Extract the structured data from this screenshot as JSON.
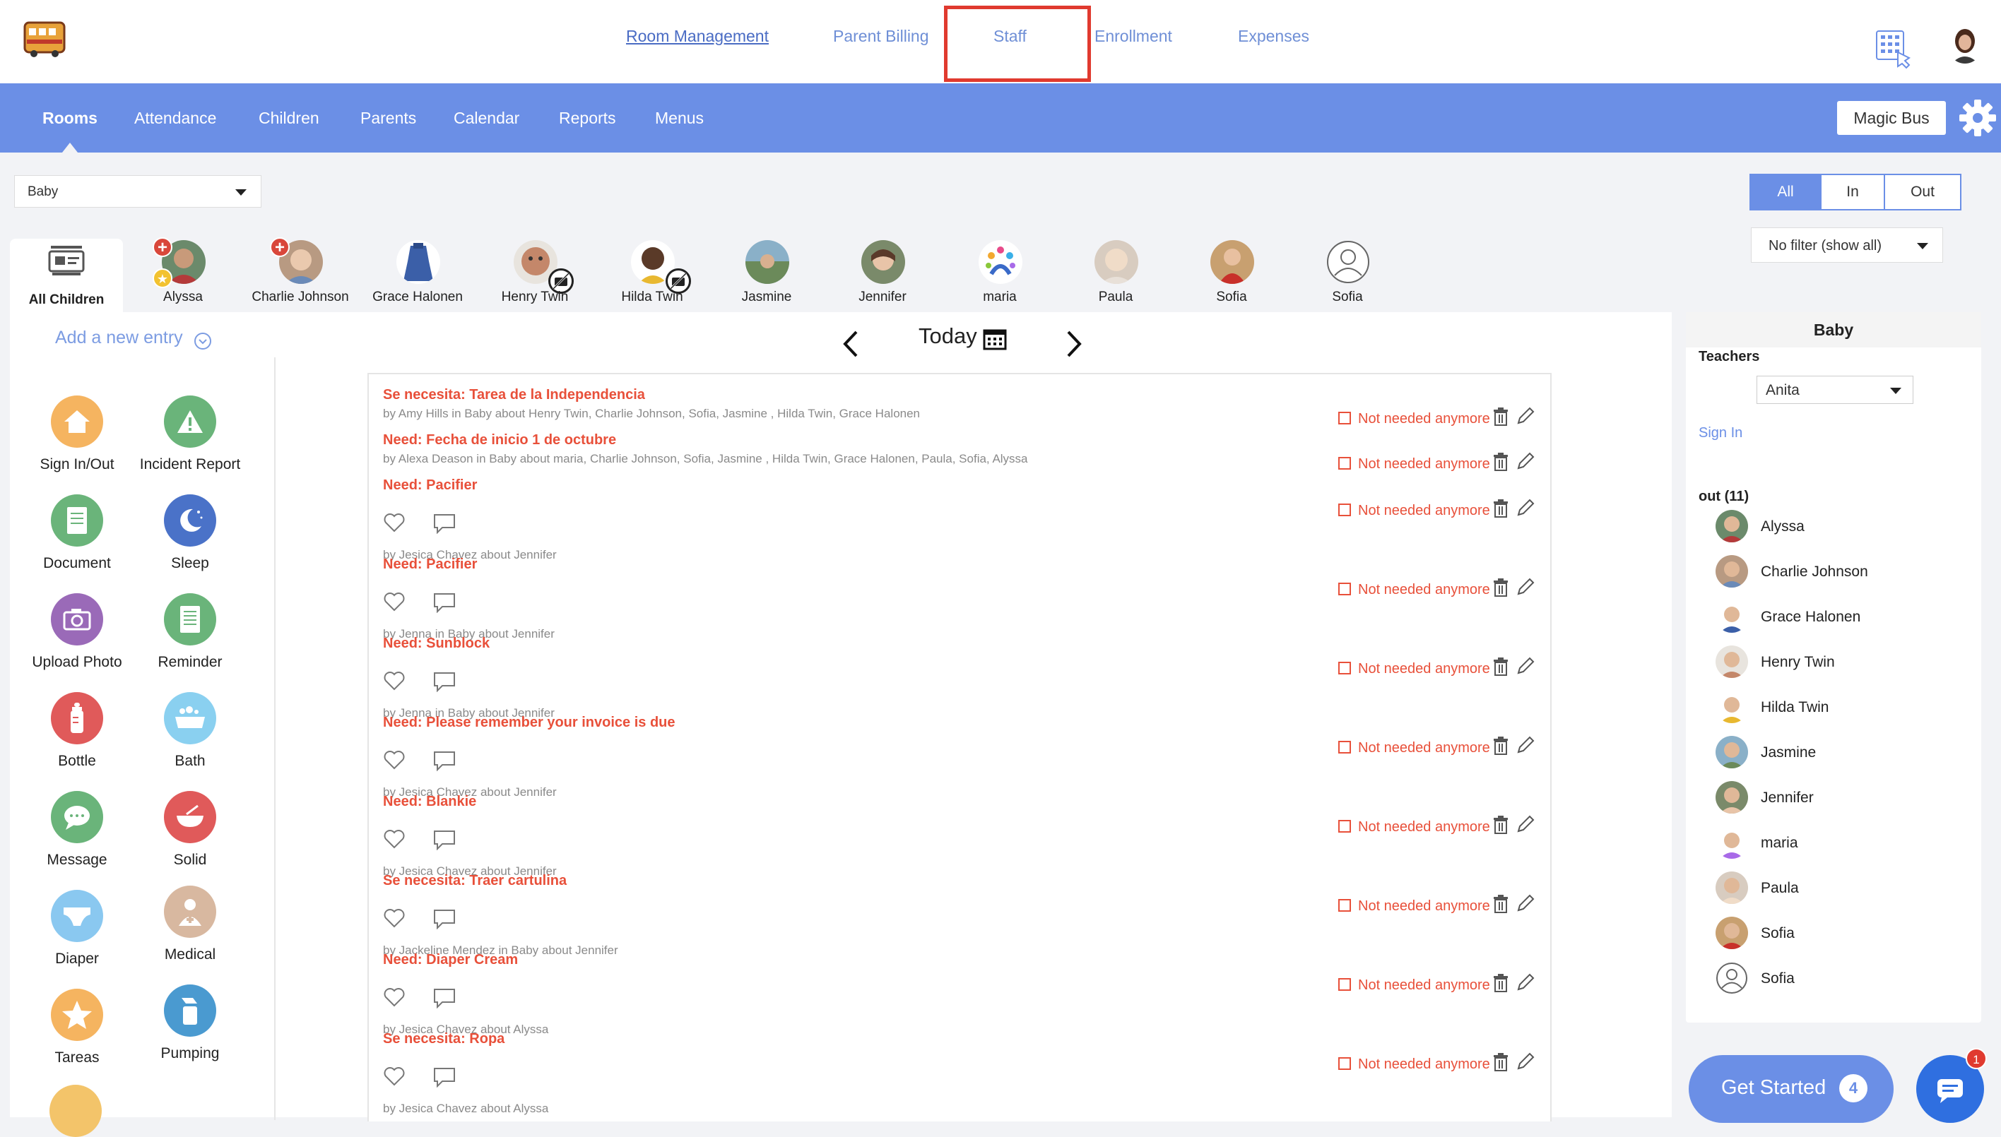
{
  "topnav": {
    "items": [
      {
        "label": "Room Management",
        "x": 0
      },
      {
        "label": "Parent Billing"
      },
      {
        "label": "Staff"
      },
      {
        "label": "Enrollment"
      },
      {
        "label": "Expenses"
      }
    ]
  },
  "bluenav": {
    "items": [
      "Rooms",
      "Attendance",
      "Children",
      "Parents",
      "Calendar",
      "Reports",
      "Menus"
    ],
    "school": "Magic Bus"
  },
  "room_select": {
    "value": "Baby"
  },
  "filters": {
    "all": "All",
    "in": "In",
    "out": "Out",
    "status": "No filter (show all)"
  },
  "children_bar": {
    "all_label": "All Children",
    "kids": [
      "Alyssa",
      "Charlie Johnson",
      "Grace Halonen",
      "Henry Twin",
      "Hilda Twin",
      "Jasmine",
      "Jennifer",
      "maria",
      "Paula",
      "Sofia",
      "Sofia"
    ]
  },
  "add_entry": "Add a new entry",
  "actions": [
    "Sign In/Out",
    "Incident Report",
    "Document",
    "Sleep",
    "Upload Photo",
    "Reminder",
    "Bottle",
    "Bath",
    "Message",
    "Solid",
    "Diaper",
    "Medical",
    "Tareas",
    "Pumping"
  ],
  "date": {
    "label": "Today"
  },
  "feed": {
    "not_needed": "Not needed anymore",
    "entries": [
      {
        "title": "Se necesita: Tarea de la Independencia",
        "by": "by Amy Hills in Baby about Henry Twin, Charlie Johnson, Sofia, Jasmine , Hilda Twin, Grace Halonen"
      },
      {
        "title": "Need: Fecha de inicio 1 de octubre",
        "by": "by Alexa Deason in Baby about maria, Charlie Johnson, Sofia, Jasmine , Hilda Twin, Grace Halonen, Paula, Sofia, Alyssa"
      },
      {
        "title": "Need: Pacifier",
        "by": "by Jesica Chavez about Jennifer"
      },
      {
        "title": "Need: Pacifier",
        "by": "by Jenna in Baby about Jennifer"
      },
      {
        "title": "Need: Sunblock",
        "by": "by Jenna in Baby about Jennifer"
      },
      {
        "title": "Need: Please remember your invoice is due",
        "by": "by Jesica Chavez about Jennifer"
      },
      {
        "title": "Need: Blankie",
        "by": "by Jesica Chavez about Jennifer"
      },
      {
        "title": "Se necesita: Traer cartulina",
        "by": "by Jackeline Mendez in Baby about Jennifer"
      },
      {
        "title": "Need: Diaper Cream",
        "by": "by Jesica Chavez about Alyssa"
      },
      {
        "title": "Se necesita: Ropa",
        "by": "by Jesica Chavez about Alyssa"
      }
    ]
  },
  "right_panel": {
    "room": "Baby",
    "teachers_label": "Teachers",
    "teacher": "Anita",
    "sign_in": "Sign In",
    "out_label": "out (11)",
    "kids": [
      "Alyssa",
      "Charlie Johnson",
      "Grace Halonen",
      "Henry Twin",
      "Hilda Twin",
      "Jasmine",
      "Jennifer",
      "maria",
      "Paula",
      "Sofia",
      "Sofia"
    ]
  },
  "get_started": {
    "label": "Get Started",
    "badge": "4"
  },
  "chat": {
    "badge": "1"
  },
  "colors": {
    "accent": "#6b8fe6",
    "need_red": "#e8503a",
    "highlight": "#e03a2f"
  }
}
